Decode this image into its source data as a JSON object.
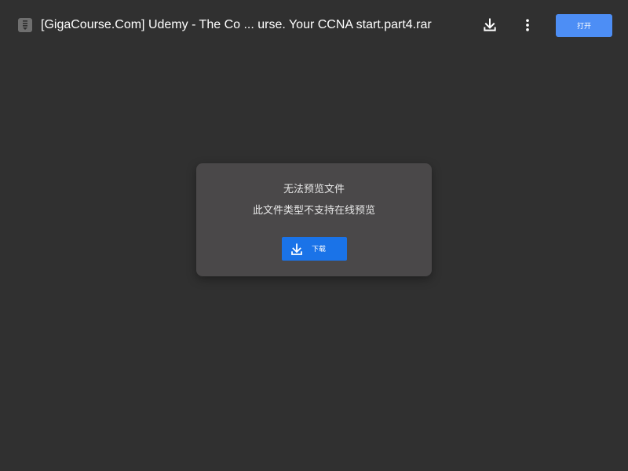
{
  "header": {
    "file_icon": "archive-file-icon",
    "title": "[GigaCourse.Com] Udemy - The Co ... urse. Your CCNA start.part4.rar",
    "download_icon": "download-icon",
    "more_icon": "more-vert-icon",
    "open_label": "打开"
  },
  "dialog": {
    "line1": "无法预览文件",
    "line2": "此文件类型不支持在线预览",
    "download_icon": "download-icon",
    "download_label": "下载"
  },
  "colors": {
    "background": "#303030",
    "dialog_background": "#4a4849",
    "primary_blue": "#1a73e8",
    "open_button_blue": "#4d8ef5"
  }
}
